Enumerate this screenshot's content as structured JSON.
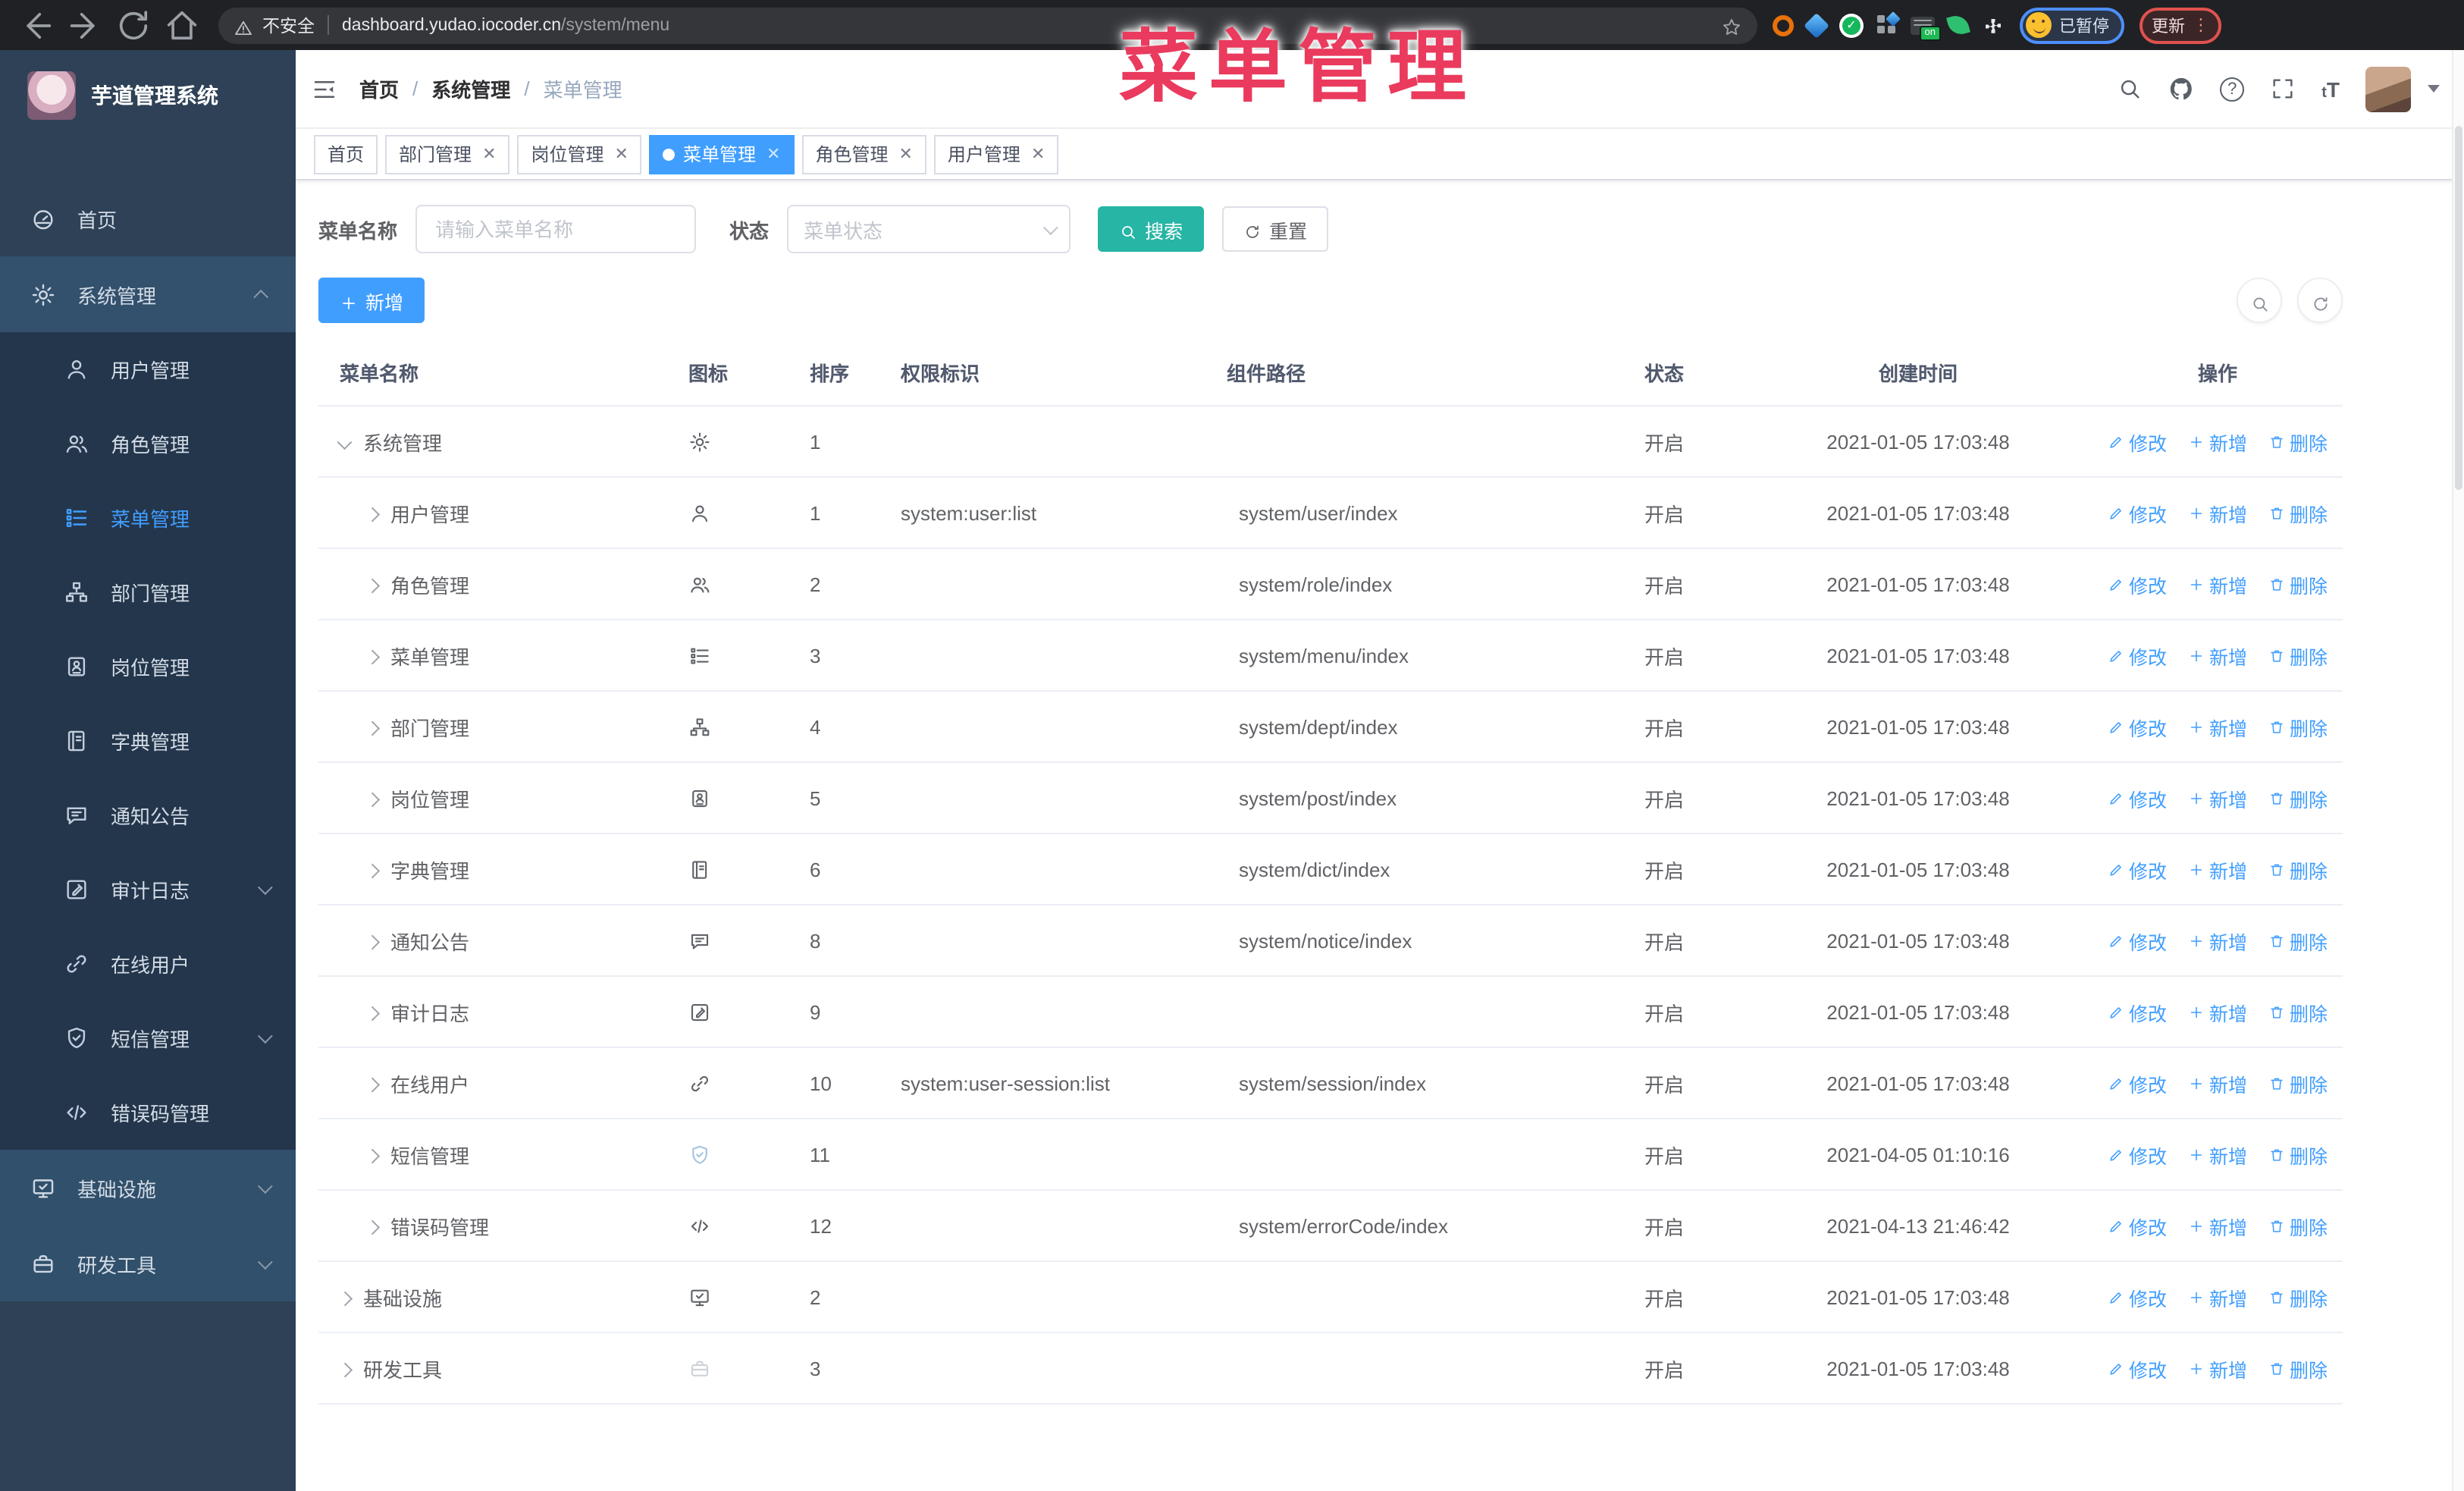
{
  "browser": {
    "security_label": "不安全",
    "url_host": "dashboard.yudao.iocoder.cn",
    "url_path": "/system/menu",
    "switch_on_label": "on",
    "paused_label": "已暂停",
    "update_label": "更新",
    "update_dots": "⋮"
  },
  "overlay": {
    "title": "菜单管理"
  },
  "sidebar": {
    "logo_title": "芋道管理系统",
    "items": [
      {
        "label": "首页",
        "icon": "dashboard-icon",
        "type": "root"
      },
      {
        "label": "系统管理",
        "icon": "gear-icon",
        "type": "root-open",
        "chevron": "up"
      },
      {
        "label": "用户管理",
        "icon": "user-icon",
        "type": "sub"
      },
      {
        "label": "角色管理",
        "icon": "users-icon",
        "type": "sub"
      },
      {
        "label": "菜单管理",
        "icon": "menu-list-icon",
        "type": "sub",
        "active": true
      },
      {
        "label": "部门管理",
        "icon": "org-tree-icon",
        "type": "sub"
      },
      {
        "label": "岗位管理",
        "icon": "badge-icon",
        "type": "sub"
      },
      {
        "label": "字典管理",
        "icon": "book-icon",
        "type": "sub"
      },
      {
        "label": "通知公告",
        "icon": "chat-icon",
        "type": "sub"
      },
      {
        "label": "审计日志",
        "icon": "edit-note-icon",
        "type": "sub",
        "chevron": "down"
      },
      {
        "label": "在线用户",
        "icon": "link-icon",
        "type": "sub"
      },
      {
        "label": "短信管理",
        "icon": "shield-icon",
        "type": "sub",
        "chevron": "down"
      },
      {
        "label": "错误码管理",
        "icon": "code-icon",
        "type": "sub"
      },
      {
        "label": "基础设施",
        "icon": "monitor-icon",
        "type": "rootlike",
        "chevron": "down"
      },
      {
        "label": "研发工具",
        "icon": "toolbox-icon",
        "type": "rootlike",
        "chevron": "down"
      }
    ]
  },
  "header": {
    "breadcrumb": [
      "首页",
      "系统管理",
      "菜单管理"
    ]
  },
  "tags": [
    {
      "label": "首页",
      "closable": false,
      "active": false
    },
    {
      "label": "部门管理",
      "closable": true,
      "active": false
    },
    {
      "label": "岗位管理",
      "closable": true,
      "active": false
    },
    {
      "label": "菜单管理",
      "closable": true,
      "active": true
    },
    {
      "label": "角色管理",
      "closable": true,
      "active": false
    },
    {
      "label": "用户管理",
      "closable": true,
      "active": false
    }
  ],
  "filters": {
    "name_label": "菜单名称",
    "name_placeholder": "请输入菜单名称",
    "status_label": "状态",
    "status_placeholder": "菜单状态",
    "search_label": "搜索",
    "reset_label": "重置"
  },
  "toolbar": {
    "add_label": "新增"
  },
  "table": {
    "columns": [
      "菜单名称",
      "图标",
      "排序",
      "权限标识",
      "组件路径",
      "状态",
      "创建时间",
      "操作"
    ],
    "op_labels": [
      "修改",
      "新增",
      "删除"
    ],
    "rows": [
      {
        "name": "系统管理",
        "level": 0,
        "expanded": true,
        "icon": "gear-icon",
        "sort": "1",
        "perm": "",
        "path": "",
        "status": "开启",
        "time": "2021-01-05 17:03:48"
      },
      {
        "name": "用户管理",
        "level": 1,
        "expanded": false,
        "icon": "user-icon",
        "sort": "1",
        "perm": "system:user:list",
        "path": "system/user/index",
        "status": "开启",
        "time": "2021-01-05 17:03:48"
      },
      {
        "name": "角色管理",
        "level": 1,
        "expanded": false,
        "icon": "users-icon",
        "sort": "2",
        "perm": "",
        "path": "system/role/index",
        "status": "开启",
        "time": "2021-01-05 17:03:48"
      },
      {
        "name": "菜单管理",
        "level": 1,
        "expanded": false,
        "icon": "menu-list-icon",
        "sort": "3",
        "perm": "",
        "path": "system/menu/index",
        "status": "开启",
        "time": "2021-01-05 17:03:48"
      },
      {
        "name": "部门管理",
        "level": 1,
        "expanded": false,
        "icon": "org-tree-icon",
        "sort": "4",
        "perm": "",
        "path": "system/dept/index",
        "status": "开启",
        "time": "2021-01-05 17:03:48"
      },
      {
        "name": "岗位管理",
        "level": 1,
        "expanded": false,
        "icon": "badge-icon",
        "sort": "5",
        "perm": "",
        "path": "system/post/index",
        "status": "开启",
        "time": "2021-01-05 17:03:48"
      },
      {
        "name": "字典管理",
        "level": 1,
        "expanded": false,
        "icon": "book-icon",
        "sort": "6",
        "perm": "",
        "path": "system/dict/index",
        "status": "开启",
        "time": "2021-01-05 17:03:48"
      },
      {
        "name": "通知公告",
        "level": 1,
        "expanded": false,
        "icon": "chat-icon",
        "sort": "8",
        "perm": "",
        "path": "system/notice/index",
        "status": "开启",
        "time": "2021-01-05 17:03:48"
      },
      {
        "name": "审计日志",
        "level": 1,
        "expanded": false,
        "icon": "edit-note-icon",
        "sort": "9",
        "perm": "",
        "path": "",
        "status": "开启",
        "time": "2021-01-05 17:03:48"
      },
      {
        "name": "在线用户",
        "level": 1,
        "expanded": false,
        "icon": "link-icon",
        "sort": "10",
        "perm": "system:user-session:list",
        "path": "system/session/index",
        "status": "开启",
        "time": "2021-01-05 17:03:48"
      },
      {
        "name": "短信管理",
        "level": 1,
        "expanded": false,
        "icon": "shield-icon",
        "sort": "11",
        "perm": "",
        "path": "",
        "status": "开启",
        "time": "2021-04-05 01:10:16"
      },
      {
        "name": "错误码管理",
        "level": 1,
        "expanded": false,
        "icon": "code-icon",
        "sort": "12",
        "perm": "",
        "path": "system/errorCode/index",
        "status": "开启",
        "time": "2021-04-13 21:46:42"
      },
      {
        "name": "基础设施",
        "level": 0,
        "expanded": false,
        "icon": "monitor-icon",
        "sort": "2",
        "perm": "",
        "path": "",
        "status": "开启",
        "time": "2021-01-05 17:03:48"
      },
      {
        "name": "研发工具",
        "level": 0,
        "expanded": false,
        "icon": "toolbox-icon",
        "sort": "3",
        "perm": "",
        "path": "",
        "status": "开启",
        "time": "2021-01-05 17:03:48"
      }
    ]
  }
}
